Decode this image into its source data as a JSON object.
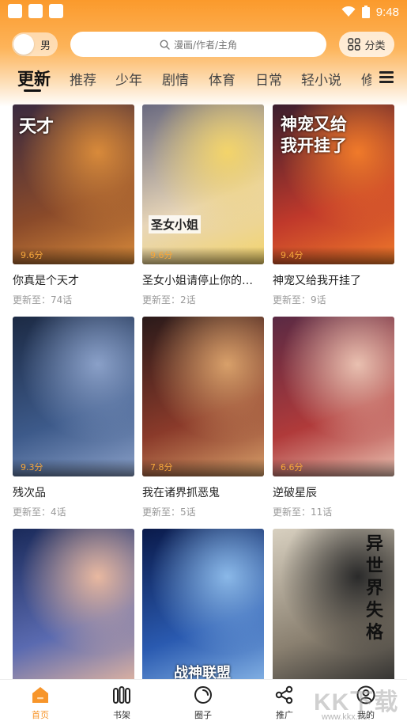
{
  "gender": {
    "label": "男"
  },
  "search": {
    "placeholder": "漫画/作者/主角"
  },
  "category_button": {
    "label": "分类"
  },
  "status_bar": {
    "time": "9:48"
  },
  "tabs": [
    {
      "label": "更新",
      "active": true
    },
    {
      "label": "推荐"
    },
    {
      "label": "少年"
    },
    {
      "label": "剧情"
    },
    {
      "label": "体育"
    },
    {
      "label": "日常"
    },
    {
      "label": "轻小说"
    },
    {
      "label": "修"
    }
  ],
  "comics": [
    {
      "title": "你真是个天才",
      "update": "更新至：74话",
      "score": "9.6分",
      "cover_text": "天才",
      "cover_colors": [
        "#3a2a3f",
        "#8a4a2a",
        "#d88a3a"
      ]
    },
    {
      "title": "圣女小姐请停止你的…",
      "update": "更新至：2话",
      "score": "9.6分",
      "cover_text": "圣女小姐",
      "cover_colors": [
        "#6a6a80",
        "#e8d6b8",
        "#f3d46a"
      ]
    },
    {
      "title": "神宠又给我开挂了",
      "update": "更新至：9话",
      "score": "9.4分",
      "cover_text": "神宠又给我开挂了",
      "cover_colors": [
        "#3a1e2e",
        "#c0392b",
        "#f07a2a"
      ]
    },
    {
      "title": "残次品",
      "update": "更新至：4话",
      "score": "9.3分",
      "cover_text": "",
      "cover_colors": [
        "#1c2a44",
        "#3d5a8a",
        "#8aa0c8"
      ]
    },
    {
      "title": "我在诸界抓恶鬼",
      "update": "更新至：5话",
      "score": "7.8分",
      "cover_text": "",
      "cover_colors": [
        "#2a1a1a",
        "#8a3a2a",
        "#d8a06a"
      ]
    },
    {
      "title": "逆破星辰",
      "update": "更新至：11话",
      "score": "6.6分",
      "cover_text": "",
      "cover_colors": [
        "#5a2a44",
        "#b03a3a",
        "#e9c0b0"
      ]
    },
    {
      "title": "",
      "update": "",
      "score": "",
      "cover_text": "",
      "cover_colors": [
        "#1a2a5a",
        "#5a6ab0",
        "#e8b8a0"
      ]
    },
    {
      "title": "",
      "update": "",
      "score": "",
      "cover_text": "战神联盟",
      "cover_colors": [
        "#0a1a4a",
        "#2a5ab0",
        "#8ab8e8"
      ]
    },
    {
      "title": "",
      "update": "",
      "score": "",
      "cover_text": "异世界失格",
      "cover_colors": [
        "#d8d0c0",
        "#8a8070",
        "#2a2a2a"
      ]
    }
  ],
  "bottom_nav": [
    {
      "label": "首页",
      "icon": "home-icon",
      "active": true
    },
    {
      "label": "书架",
      "icon": "bookshelf-icon"
    },
    {
      "label": "圈子",
      "icon": "circle-icon"
    },
    {
      "label": "推广",
      "icon": "share-icon"
    },
    {
      "label": "我的",
      "icon": "profile-icon"
    }
  ],
  "watermark": {
    "text": "KK下载",
    "url": "www.kkx.net"
  },
  "colors": {
    "accent": "#f7952a",
    "score": "#f6a63b",
    "header": "#fb9a2c"
  }
}
